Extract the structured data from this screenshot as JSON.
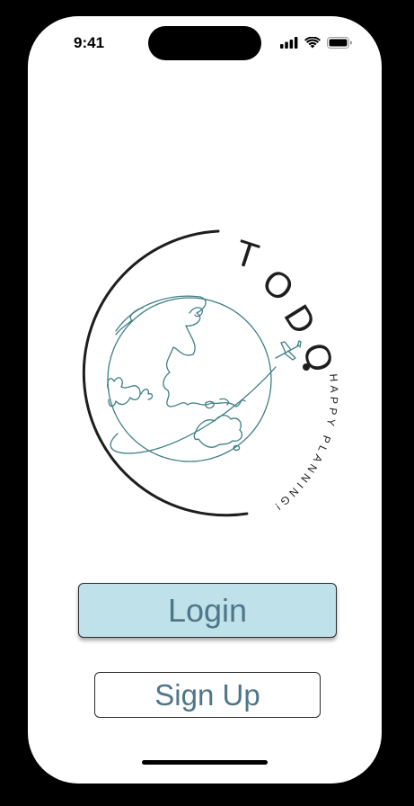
{
  "status_bar": {
    "time": "9:41",
    "icons": [
      "cellular-signal-icon",
      "wifi-icon",
      "battery-icon"
    ]
  },
  "logo": {
    "title": "TODO",
    "tagline": "HAPPY PLANNING!",
    "icon": "globe-airplane-icon",
    "colors": {
      "ring": "#1e1e1e",
      "globe": "#3e7f86"
    }
  },
  "actions": {
    "login_label": "Login",
    "signup_label": "Sign Up"
  },
  "colors": {
    "login_background": "#bfe1ea",
    "button_text": "#4f7688"
  }
}
